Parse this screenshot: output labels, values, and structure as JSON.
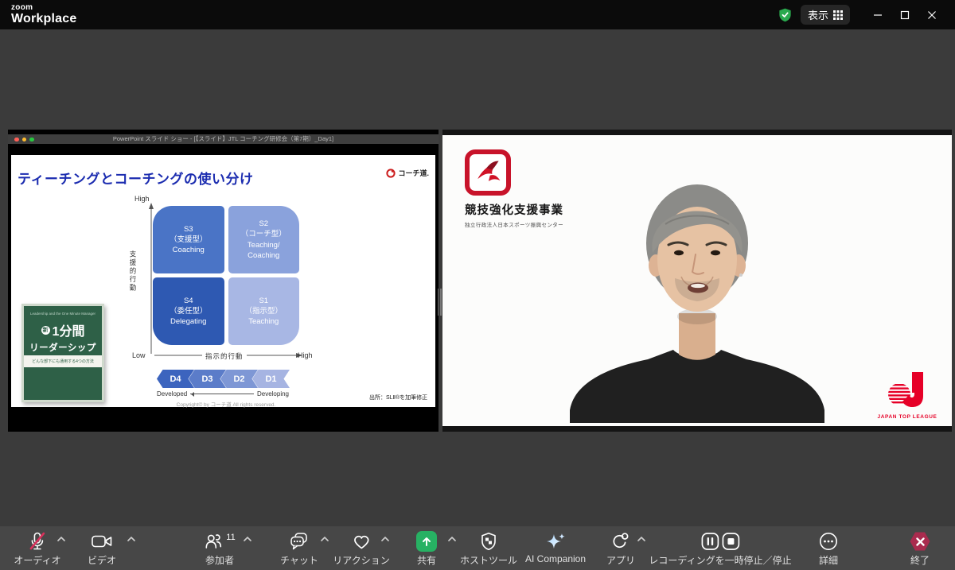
{
  "topbar": {
    "brand_small": "zoom",
    "brand_large": "Workplace",
    "view_label": "表示"
  },
  "shared_screen": {
    "window_title": "PowerPoint スライド ショー - [【スライド】JTL コーチング研修会（第7期）_Day1]",
    "slide": {
      "title": "ティーチングとコーチングの使い分け",
      "brand": "コーチ道.",
      "axes": {
        "y_high": "High",
        "y_low": "Low",
        "y_label": "支援的行動",
        "x_label": "指示的行動",
        "x_high": "High"
      },
      "quadrants": [
        {
          "lines": [
            "S3",
            "（支援型）",
            "Coaching"
          ],
          "color": "#4a74c6"
        },
        {
          "lines": [
            "S2",
            "（コーチ型）",
            "Teaching/",
            "Coaching"
          ],
          "color": "#8aa2dc"
        },
        {
          "lines": [
            "S4",
            "（委任型）",
            "Delegating"
          ],
          "color": "#2e59b2"
        },
        {
          "lines": [
            "S1",
            "（指示型）",
            "Teaching"
          ],
          "color": "#a8b7e4"
        }
      ],
      "dev_levels": [
        {
          "label": "D4",
          "color": "#3c64be"
        },
        {
          "label": "D3",
          "color": "#5b7cc9"
        },
        {
          "label": "D2",
          "color": "#7e97d5"
        },
        {
          "label": "D1",
          "color": "#a6b4e2"
        }
      ],
      "dev_left": "Developed",
      "dev_right": "Developing",
      "copyright": "Copyright© by コーチ道 All rights reserved.",
      "source": "出所：SLⅡ®を加筆修正",
      "book": {
        "top_text": "Leadership and the One Minute Manager",
        "badge": "新",
        "title1": "1分間",
        "title2": "リーダーシップ",
        "subtitle": "どんな部下にも通用する4つの方法"
      }
    }
  },
  "video_panel": {
    "program_title": "競技強化支援事業",
    "program_subtitle": "独立行政法人日本スポーツ振興センター",
    "league_name": "JAPAN TOP LEAGUE"
  },
  "toolbar": {
    "items": [
      {
        "label": "オーディオ"
      },
      {
        "label": "ビデオ"
      },
      {
        "label": "参加者",
        "badge": "11"
      },
      {
        "label": "チャット"
      },
      {
        "label": "リアクション"
      },
      {
        "label": "共有"
      },
      {
        "label": "ホストツール"
      },
      {
        "label": "AI Companion"
      },
      {
        "label": "アプリ"
      },
      {
        "label": "レコーディングを一時停止／停止"
      },
      {
        "label": "詳細"
      },
      {
        "label": "終了"
      }
    ],
    "colors": {
      "share_green": "#27b163",
      "end_red": "#a92b4e",
      "mute_red": "#d8315b"
    }
  }
}
